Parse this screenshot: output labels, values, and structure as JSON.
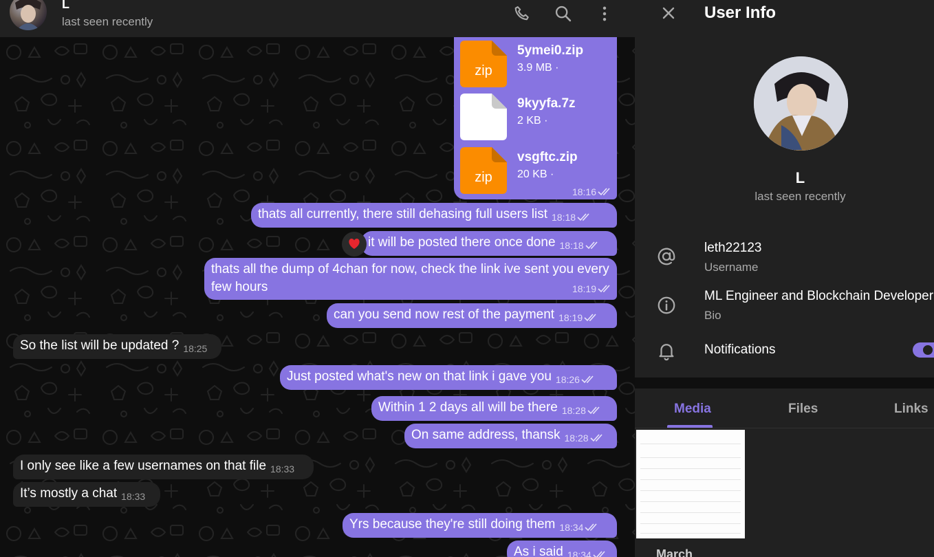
{
  "chat": {
    "header": {
      "name": "L",
      "status": "last seen recently",
      "icons": [
        "phone-icon",
        "search-icon",
        "more-vertical-icon"
      ]
    },
    "files": [
      {
        "name": "5ymei0.zip",
        "size": "3.9 MB ·",
        "ext": "zip",
        "icon_color": "#fb8c00"
      },
      {
        "name": "9kyyfa.7z",
        "size": "2 KB ·",
        "ext": "",
        "icon_color": "#ffffff"
      },
      {
        "name": "vsgftc.zip",
        "size": "20 KB ·",
        "ext": "zip",
        "icon_color": "#fb8c00"
      }
    ],
    "files_time": "18:16",
    "messages": [
      {
        "dir": "out",
        "text": "thats all currently, there still dehasing full users list",
        "time": "18:18"
      },
      {
        "dir": "out",
        "text": "it will be posted there once done",
        "time": "18:18",
        "reaction": "❤️"
      },
      {
        "dir": "out",
        "text": "thats all the dump of 4chan for now, check the link ive sent you every few hours",
        "time": "18:19"
      },
      {
        "dir": "out",
        "text": "can you send now rest of the payment",
        "time": "18:19"
      },
      {
        "dir": "in",
        "text": "So the list will be updated ?",
        "time": "18:25"
      },
      {
        "dir": "out",
        "text": "Just posted what's new on that link i gave you",
        "time": "18:26"
      },
      {
        "dir": "out",
        "text": "Within 1 2 days all will be there",
        "time": "18:28"
      },
      {
        "dir": "out",
        "text": "On same address, thansk",
        "time": "18:28"
      },
      {
        "dir": "in",
        "text": "I only see like a few usernames on that file",
        "time": "18:33"
      },
      {
        "dir": "in",
        "text": "It’s mostly a chat",
        "time": "18:33"
      },
      {
        "dir": "out",
        "text": "Yrs because they're still doing them",
        "time": "18:34"
      },
      {
        "dir": "out",
        "text": "As i said",
        "time": "18:34"
      }
    ]
  },
  "info": {
    "title": "User Info",
    "name": "L",
    "status": "last seen recently",
    "username": "leth22123",
    "username_label": "Username",
    "bio": "ML Engineer and Blockchain Developer",
    "bio_label": "Bio",
    "notifications_label": "Notifications",
    "notifications_on": true,
    "tabs": [
      "Media",
      "Files",
      "Links"
    ],
    "active_tab": "Media",
    "month_label": "March"
  },
  "colors": {
    "accent": "#8774e1",
    "panel": "#212121",
    "background": "#0e0e0e",
    "secondary_text": "#aaaaaa",
    "zip_orange": "#fb8c00"
  }
}
